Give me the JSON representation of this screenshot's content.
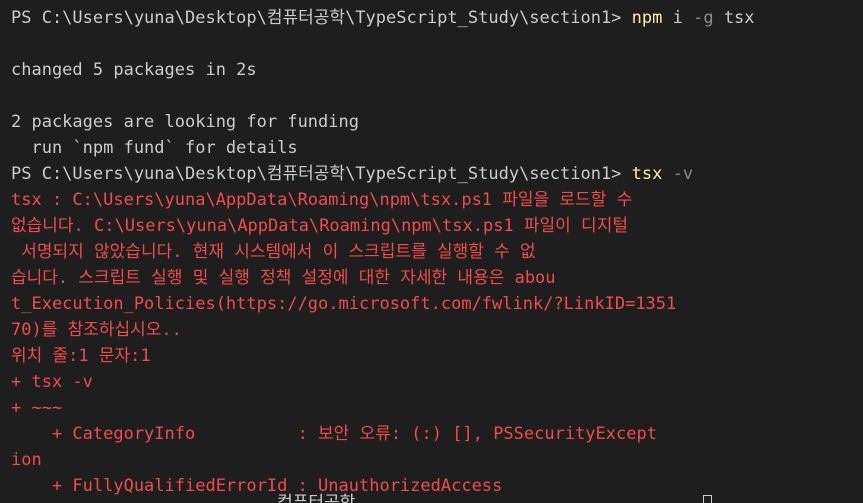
{
  "terminal": {
    "colors": {
      "background": "#1e1e1e",
      "foreground": "#cccccc",
      "command": "#f9f1a5",
      "flag": "#8a8a8a",
      "error": "#f14c4c"
    },
    "prompt1": {
      "prompt": "PS C:\\Users\\yuna\\Desktop\\컴퓨터공학\\TypeScript_Study\\section1> ",
      "cmd": "npm",
      "args": " i ",
      "flag": "-g",
      "rest": " tsx"
    },
    "out1": "changed 5 packages in 2s",
    "out2": "2 packages are looking for funding",
    "out3": "  run `npm fund` for details",
    "prompt2": {
      "prompt": "PS C:\\Users\\yuna\\Desktop\\컴퓨터공학\\TypeScript_Study\\section1> ",
      "cmd": "tsx",
      "flag": " -v"
    },
    "error_lines": [
      "tsx : C:\\Users\\yuna\\AppData\\Roaming\\npm\\tsx.ps1 파일을 로드할 수",
      "없습니다. C:\\Users\\yuna\\AppData\\Roaming\\npm\\tsx.ps1 파일이 디지털",
      " 서명되지 않았습니다. 현재 시스템에서 이 스크립트를 실행할 수 없",
      "습니다. 스크립트 실행 및 실행 정책 설정에 대한 자세한 내용은 abou",
      "t_Execution_Policies(https://go.microsoft.com/fwlink/?LinkID=1351",
      "70)를 참조하십시오..",
      "위치 줄:1 문자:1",
      "+ tsx -v",
      "+ ~~~",
      "    + CategoryInfo          : 보안 오류: (:) [], PSSecurityExcept",
      "ion",
      "    + FullyQualifiedErrorId : UnauthorizedAccess"
    ],
    "bottom_partial": "                          컴퓨터공학"
  }
}
